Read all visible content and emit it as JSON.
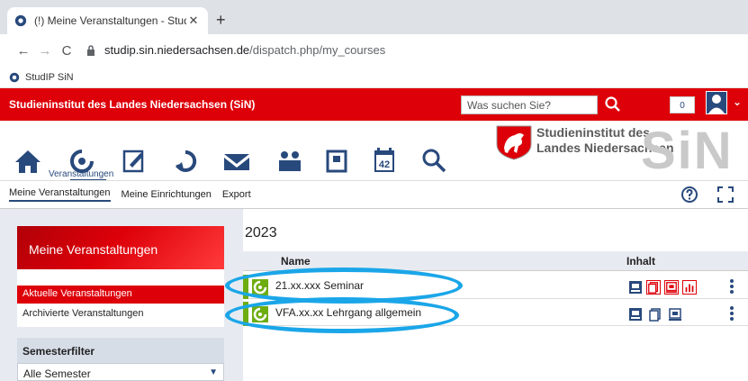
{
  "browser": {
    "tab_title": "(!) Meine Veranstaltungen - Stud",
    "url_host": "studip.sin.niedersachsen.de",
    "url_path": "/dispatch.php/my_courses",
    "bookmark": "StudIP SiN"
  },
  "header": {
    "org_name": "Studieninstitut des Landes Niedersachsen (SiN)",
    "search_placeholder": "Was suchen Sie?",
    "notification_count": "0",
    "active_nav_label": "Veranstaltungen",
    "brand_text_line1": "Studieninstitut des",
    "brand_text_line2": "Landes Niedersachsen",
    "brand_logo": "SiN",
    "calendar_day": "42"
  },
  "subnav": {
    "items": [
      "Meine Veranstaltungen",
      "Meine Einrichtungen",
      "Export"
    ]
  },
  "sidebar": {
    "title": "Meine Veranstaltungen",
    "items": [
      "Aktuelle Veranstaltungen",
      "Archivierte Veranstaltungen"
    ],
    "filter_title": "Semesterfilter",
    "filter_value": "Alle Semester"
  },
  "main": {
    "year": "2023",
    "columns": [
      "Name",
      "Inhalt"
    ],
    "courses": [
      {
        "name": "21.xx.xxx Seminar"
      },
      {
        "name": "VFA.xx.xx Lehrgang allgemein"
      }
    ]
  },
  "colors": {
    "brand_red": "#dd0009",
    "studip_blue": "#28497c",
    "course_green": "#6ead10",
    "highlight_blue": "#1aa6e8"
  }
}
